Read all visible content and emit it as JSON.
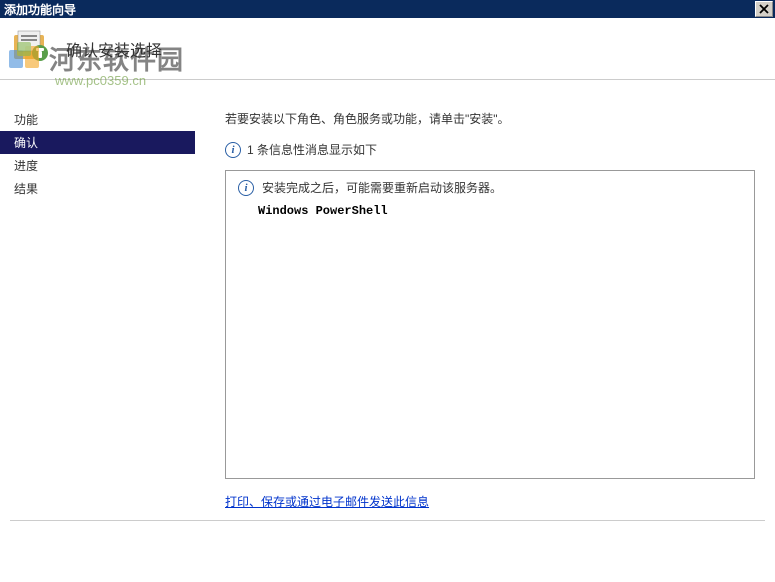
{
  "titlebar": {
    "title": "添加功能向导"
  },
  "watermark": {
    "brand_text": "河东软件园",
    "url_text": "www.pc0359.cn"
  },
  "header": {
    "subtitle": "确认安装选择"
  },
  "sidebar": {
    "items": [
      {
        "label": "功能",
        "active": false
      },
      {
        "label": "确认",
        "active": true
      },
      {
        "label": "进度",
        "active": false
      },
      {
        "label": "结果",
        "active": false
      }
    ]
  },
  "main": {
    "instruction": "若要安装以下角色、角色服务或功能，请单击\"安装\"。",
    "info_messages_text": "1 条信息性消息显示如下",
    "warning_text": "安装完成之后，可能需要重新启动该服务器。",
    "feature_name": "Windows PowerShell",
    "link_text": "打印、保存或通过电子邮件发送此信息"
  }
}
